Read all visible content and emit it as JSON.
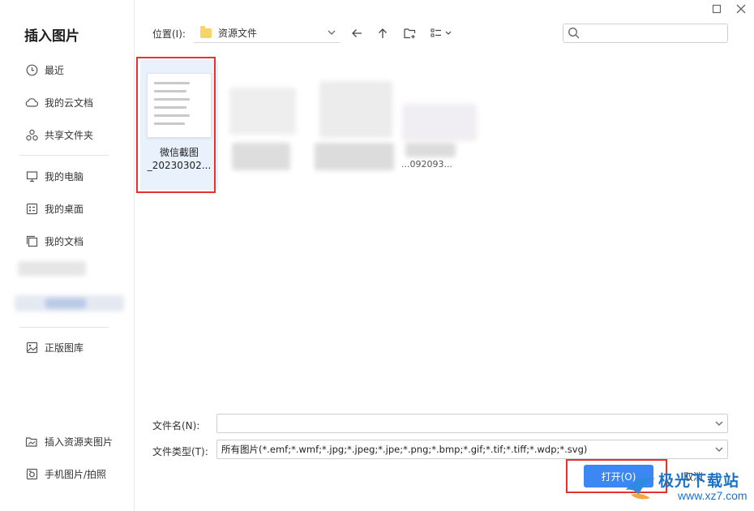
{
  "dialog": {
    "title": "插入图片"
  },
  "window_controls": {
    "maximize_icon": "square-icon",
    "close_icon": "close-icon"
  },
  "sidebar": {
    "items": [
      {
        "label": "最近",
        "icon": "clock-icon"
      },
      {
        "label": "我的云文档",
        "icon": "cloud-icon"
      },
      {
        "label": "共享文件夹",
        "icon": "share-group-icon"
      },
      {
        "label": "我的电脑",
        "icon": "monitor-icon"
      },
      {
        "label": "我的桌面",
        "icon": "desktop-icon"
      },
      {
        "label": "我的文档",
        "icon": "documents-icon"
      },
      {
        "label": "正版图库",
        "icon": "image-library-icon"
      }
    ],
    "bottom_items": [
      {
        "label": "插入资源夹图片",
        "icon": "folder-image-icon"
      },
      {
        "label": "手机图片/拍照",
        "icon": "phone-photo-icon"
      }
    ]
  },
  "toolbar": {
    "location_label": "位置(I):",
    "location_value": "资源文件",
    "search_placeholder": ""
  },
  "files": [
    {
      "name_line1": "微信截图",
      "name_line2": "_20230302...",
      "selected": true
    },
    {
      "name_line1": "",
      "name_line2": "...092093...",
      "selected": false
    }
  ],
  "form": {
    "filename_label": "文件名(N):",
    "filename_value": "",
    "filetype_label": "文件类型(T):",
    "filetype_value": "所有图片(*.emf;*.wmf;*.jpg;*.jpeg;*.jpe;*.png;*.bmp;*.gif;*.tif;*.tiff;*.wdp;*.svg)"
  },
  "buttons": {
    "open": "打开(O)",
    "cancel": "取消"
  },
  "watermark": {
    "text": "极光下载站",
    "url": "www.xz7.com"
  },
  "colors": {
    "accent": "#3d87f4",
    "highlight_box": "#e6312e",
    "selected_bg": "#e9f2fc"
  }
}
